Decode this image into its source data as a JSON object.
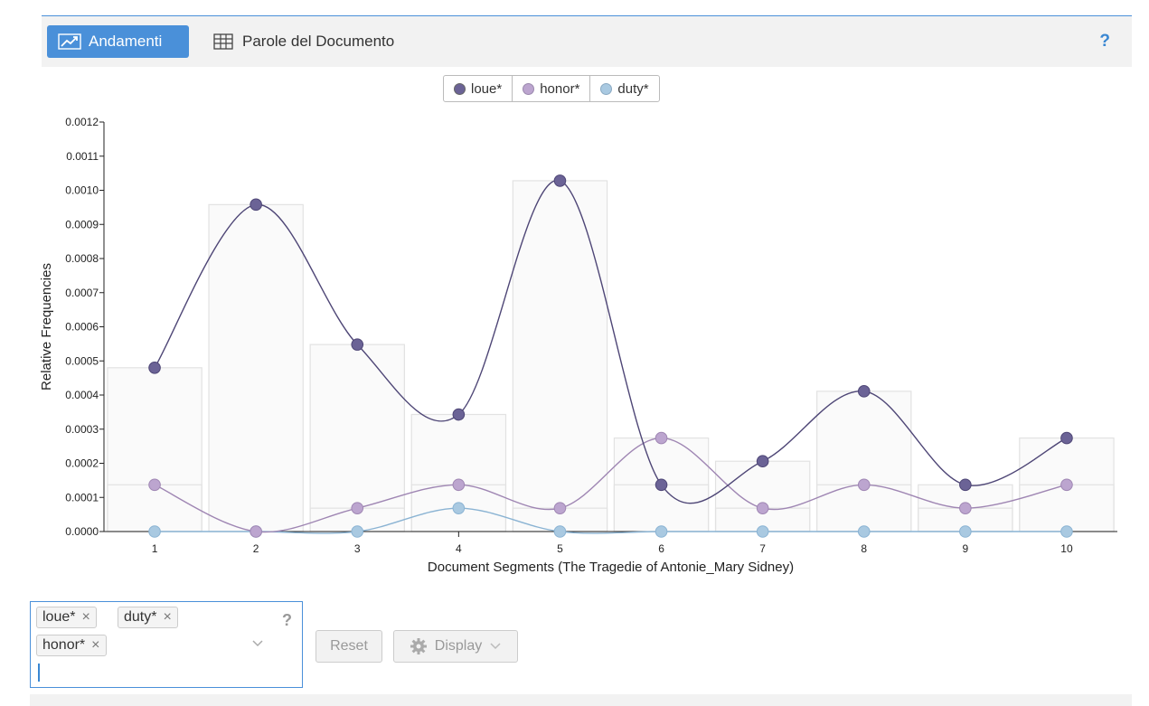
{
  "toolbar": {
    "tab_trends": "Andamenti",
    "tab_words": "Parole del Documento",
    "help": "?"
  },
  "legend": [
    "loue*",
    "honor*",
    "duty*"
  ],
  "chart_data": {
    "type": "line",
    "xlabel": "Document Segments (The Tragedie of Antonie_Mary Sidney)",
    "ylabel": "Relative Frequencies",
    "x": [
      1,
      2,
      3,
      4,
      5,
      6,
      7,
      8,
      9,
      10
    ],
    "ylim": [
      0,
      0.0012
    ],
    "yticks": [
      "0.0000",
      "0.0001",
      "0.0002",
      "0.0003",
      "0.0004",
      "0.0005",
      "0.0006",
      "0.0007",
      "0.0008",
      "0.0009",
      "0.0010",
      "0.0011",
      "0.0012"
    ],
    "series": [
      {
        "name": "loue*",
        "color": "#6b6396",
        "values": [
          0.00048,
          0.000958,
          0.000548,
          0.000343,
          0.001028,
          0.000137,
          0.000206,
          0.000411,
          0.000137,
          0.000274
        ]
      },
      {
        "name": "honor*",
        "color": "#bca5cf",
        "values": [
          0.000137,
          0.0,
          6.85e-05,
          0.000137,
          6.85e-05,
          0.000274,
          6.85e-05,
          0.000137,
          6.85e-05,
          0.000137
        ]
      },
      {
        "name": "duty*",
        "color": "#a9c9e1",
        "values": [
          0.0,
          0.0,
          0.0,
          6.85e-05,
          0.0,
          0.0,
          0.0,
          0.0,
          0.0,
          0.0
        ]
      }
    ],
    "background_bars": {
      "note_series": "max and second series per segment shown as faint bars",
      "loue*": [
        0.00048,
        0.000958,
        0.000548,
        0.000343,
        0.001028,
        0.000274,
        0.000206,
        0.000411,
        0.000137,
        0.000274
      ],
      "honor*": [
        0.000137,
        0.0,
        6.85e-05,
        0.000137,
        6.85e-05,
        0.000137,
        6.85e-05,
        0.000137,
        6.85e-05,
        0.000137
      ]
    },
    "grid": false,
    "legend_position": "top-center"
  },
  "controls": {
    "tags": [
      "loue*",
      "duty*",
      "honor*"
    ],
    "tag_remove": "×",
    "help": "?",
    "reset": "Reset",
    "display": "Display"
  }
}
